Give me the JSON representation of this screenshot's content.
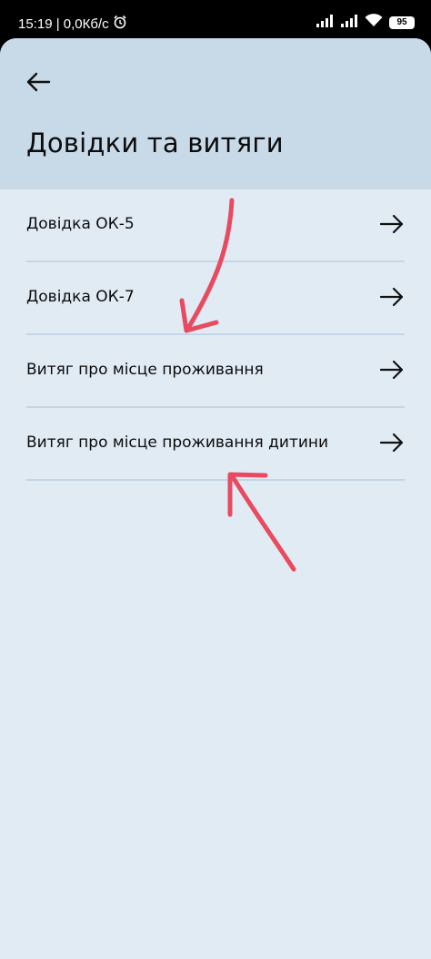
{
  "status_bar": {
    "time_speed": "15:19 | 0,0Кб/с",
    "battery": "95",
    "icons": [
      "alarm-icon",
      "signal-icon",
      "signal-icon",
      "wifi-icon",
      "battery-icon"
    ]
  },
  "header": {
    "back_icon": "arrow-left-icon",
    "title": "Довідки та витяги"
  },
  "list": {
    "items": [
      {
        "label": "Довідка ОК-5",
        "icon": "arrow-right-icon"
      },
      {
        "label": "Довідка ОК-7",
        "icon": "arrow-right-icon"
      },
      {
        "label": "Витяг про місце проживання",
        "icon": "arrow-right-icon"
      },
      {
        "label": "Витяг про місце проживання дитини",
        "icon": "arrow-right-icon"
      }
    ]
  },
  "colors": {
    "header_bg": "#c8d9e8",
    "page_bg": "#e1ebf4",
    "divider": "#c4d6e5",
    "annotation": "#e84a5f"
  }
}
